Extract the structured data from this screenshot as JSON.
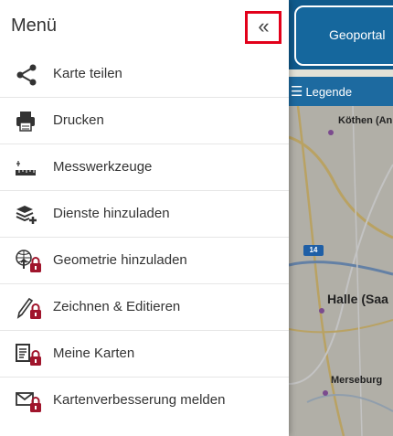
{
  "map": {
    "portal_title": "Geoportal",
    "legend_label": "Legende",
    "places": {
      "koethen": "Köthen (An",
      "halle": "Halle (Saa",
      "merseburg": "Merseburg"
    },
    "road_shield": "14"
  },
  "menu": {
    "title": "Menü",
    "collapse_symbol": "«",
    "items": [
      {
        "label": "Karte teilen",
        "icon": "share-icon",
        "locked": false
      },
      {
        "label": "Drucken",
        "icon": "printer-icon",
        "locked": false
      },
      {
        "label": "Messwerkzeuge",
        "icon": "ruler-icon",
        "locked": false
      },
      {
        "label": "Dienste hinzuladen",
        "icon": "layers-add-icon",
        "locked": false
      },
      {
        "label": "Geometrie hinzuladen",
        "icon": "globe-upload-icon",
        "locked": true
      },
      {
        "label": "Zeichnen & Editieren",
        "icon": "pencil-icon",
        "locked": true
      },
      {
        "label": "Meine Karten",
        "icon": "document-list-icon",
        "locked": true
      },
      {
        "label": "Kartenverbesserung melden",
        "icon": "mail-icon",
        "locked": true
      }
    ]
  },
  "colors": {
    "highlight": "#e2001a",
    "lock": "#a0152c",
    "header_blue": "#0f5a8c"
  }
}
